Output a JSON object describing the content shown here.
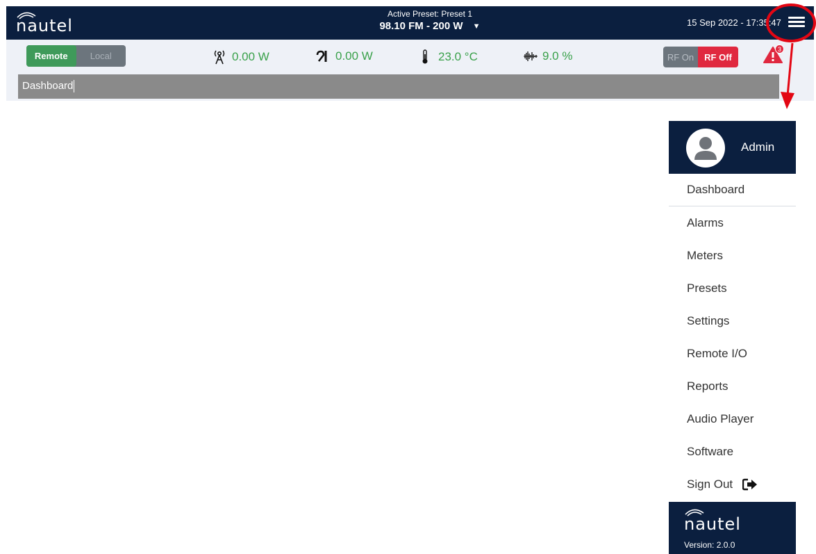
{
  "header": {
    "brand": "nautel",
    "preset_label": "Active Preset: Preset 1",
    "preset_value": "98.10 FM - 200 W",
    "datetime": "15 Sep 2022 - 17:35:47"
  },
  "status": {
    "remote_label": "Remote",
    "local_label": "Local",
    "forward_power": "0.00 W",
    "reflected_power": "0.00 W",
    "temperature": "23.0 °C",
    "modulation": "9.0 %",
    "rf_on_label": "RF On",
    "rf_off_label": "RF Off",
    "alarm_count": "3"
  },
  "breadcrumb": {
    "text": "Dashboard"
  },
  "menu": {
    "user_name": "Admin",
    "items": [
      {
        "label": "Dashboard"
      },
      {
        "label": "Alarms"
      },
      {
        "label": "Meters"
      },
      {
        "label": "Presets"
      },
      {
        "label": "Settings"
      },
      {
        "label": "Remote I/O"
      },
      {
        "label": "Reports"
      },
      {
        "label": "Audio Player"
      },
      {
        "label": "Software"
      }
    ],
    "sign_out_label": "Sign Out",
    "footer_brand": "nautel",
    "version": "Version: 2.0.0"
  },
  "colors": {
    "navy": "#0b1f3f",
    "green": "#3aa14b",
    "red": "#e0283f",
    "annotation": "#e30613"
  }
}
